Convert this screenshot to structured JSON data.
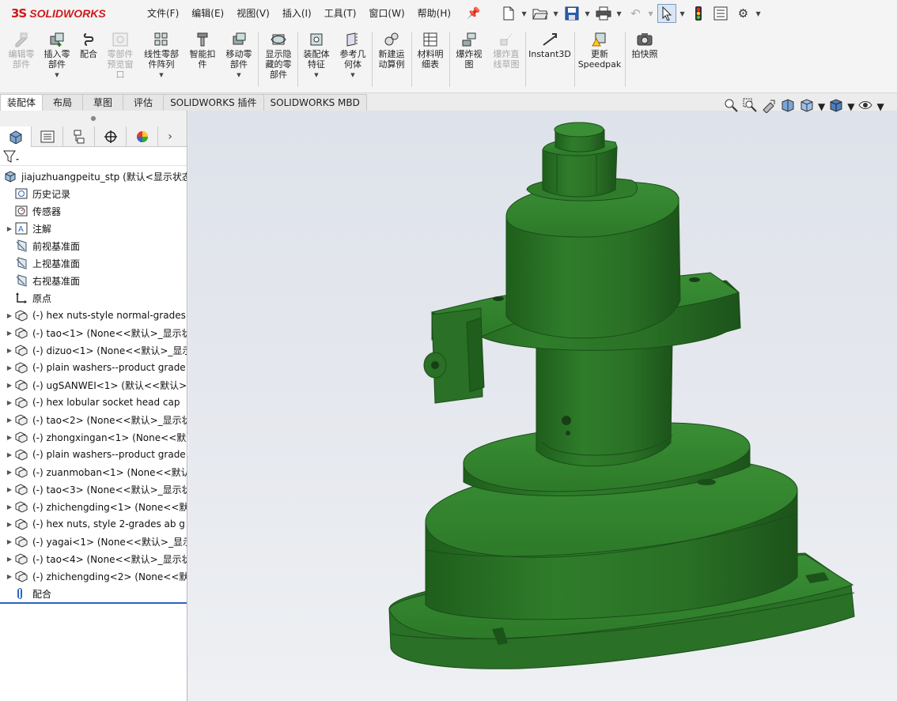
{
  "app": {
    "logo_mark": "3S",
    "logo_text": "SOLIDWORKS"
  },
  "menu": [
    {
      "label": "文件(F)"
    },
    {
      "label": "编辑(E)"
    },
    {
      "label": "视图(V)"
    },
    {
      "label": "插入(I)"
    },
    {
      "label": "工具(T)"
    },
    {
      "label": "窗口(W)"
    },
    {
      "label": "帮助(H)"
    }
  ],
  "quick_access": [
    "new-icon",
    "open-icon",
    "save-icon",
    "print-icon",
    "undo-icon",
    "select-icon",
    "rebuild-icon",
    "file-properties-icon",
    "options-icon"
  ],
  "commands": [
    {
      "l1": "编辑零",
      "l2": "部件",
      "l3": "",
      "disabled": true,
      "icon": "edit-component-icon"
    },
    {
      "l1": "插入零",
      "l2": "部件",
      "l3": "",
      "disabled": false,
      "icon": "insert-component-icon"
    },
    {
      "l1": "配合",
      "l2": "",
      "l3": "",
      "disabled": false,
      "icon": "mate-icon"
    },
    {
      "l1": "零部件",
      "l2": "预览窗",
      "l3": "口",
      "disabled": true,
      "icon": "preview-window-icon"
    },
    {
      "l1": "线性零部",
      "l2": "件阵列",
      "l3": "",
      "disabled": false,
      "icon": "linear-pattern-icon"
    },
    {
      "l1": "智能扣",
      "l2": "件",
      "l3": "",
      "disabled": false,
      "icon": "smart-fastener-icon"
    },
    {
      "l1": "移动零",
      "l2": "部件",
      "l3": "",
      "disabled": false,
      "icon": "move-component-icon"
    },
    {
      "l1": "显示隐",
      "l2": "藏的零",
      "l3": "部件",
      "disabled": false,
      "icon": "show-hidden-icon"
    },
    {
      "l1": "装配体",
      "l2": "特征",
      "l3": "",
      "disabled": false,
      "icon": "assembly-feature-icon"
    },
    {
      "l1": "参考几",
      "l2": "何体",
      "l3": "",
      "disabled": false,
      "icon": "reference-geometry-icon"
    },
    {
      "l1": "新建运",
      "l2": "动算例",
      "l3": "",
      "disabled": false,
      "icon": "motion-study-icon"
    },
    {
      "l1": "材料明",
      "l2": "细表",
      "l3": "",
      "disabled": false,
      "icon": "bom-icon"
    },
    {
      "l1": "爆炸视",
      "l2": "图",
      "l3": "",
      "disabled": false,
      "icon": "exploded-view-icon"
    },
    {
      "l1": "爆炸直",
      "l2": "线草图",
      "l3": "",
      "disabled": true,
      "icon": "explode-line-icon"
    },
    {
      "l1": "Instant3D",
      "l2": "",
      "l3": "",
      "disabled": false,
      "icon": "instant3d-icon"
    },
    {
      "l1": "更新",
      "l2": "Speedpak",
      "l3": "",
      "disabled": false,
      "icon": "speedpak-icon"
    },
    {
      "l1": "拍快照",
      "l2": "",
      "l3": "",
      "disabled": false,
      "icon": "snapshot-icon"
    }
  ],
  "tabs": [
    {
      "label": "装配体",
      "active": true
    },
    {
      "label": "布局"
    },
    {
      "label": "草图"
    },
    {
      "label": "评估"
    },
    {
      "label": "SOLIDWORKS 插件"
    },
    {
      "label": "SOLIDWORKS MBD"
    }
  ],
  "panel_tabs": [
    "featuremanager-icon",
    "propertymanager-icon",
    "configurationmanager-icon",
    "dimxpert-icon",
    "display-manager-icon"
  ],
  "tree": [
    {
      "label": "jiajuzhuangpeitu_stp  (默认<显示状态",
      "icon": "assembly-icon",
      "expander": false,
      "level": 0
    },
    {
      "label": "历史记录",
      "icon": "history-icon",
      "expander": false,
      "level": 1
    },
    {
      "label": "传感器",
      "icon": "sensor-icon",
      "expander": false,
      "level": 1
    },
    {
      "label": "注解",
      "icon": "annotation-icon",
      "expander": true,
      "level": 1
    },
    {
      "label": "前视基准面",
      "icon": "plane-icon",
      "expander": false,
      "level": 1
    },
    {
      "label": "上视基准面",
      "icon": "plane-icon",
      "expander": false,
      "level": 1
    },
    {
      "label": "右视基准面",
      "icon": "plane-icon",
      "expander": false,
      "level": 1
    },
    {
      "label": "原点",
      "icon": "origin-icon",
      "expander": false,
      "level": 1
    },
    {
      "label": "(-) hex nuts-style normal-grades",
      "icon": "part-icon",
      "expander": true,
      "level": 1
    },
    {
      "label": "(-) tao<1> (None<<默认>_显示状",
      "icon": "part-icon",
      "expander": true,
      "level": 1
    },
    {
      "label": "(-) dizuo<1> (None<<默认>_显示",
      "icon": "part-icon",
      "expander": true,
      "level": 1
    },
    {
      "label": "(-) plain washers--product grade",
      "icon": "part-icon",
      "expander": true,
      "level": 1
    },
    {
      "label": "(-) ugSANWEI<1> (默认<<默认>",
      "icon": "part-icon",
      "expander": true,
      "level": 1
    },
    {
      "label": "(-) hex lobular socket head cap",
      "icon": "part-icon",
      "expander": true,
      "level": 1
    },
    {
      "label": "(-) tao<2> (None<<默认>_显示状",
      "icon": "part-icon",
      "expander": true,
      "level": 1
    },
    {
      "label": "(-) zhongxingan<1> (None<<默",
      "icon": "part-icon",
      "expander": true,
      "level": 1
    },
    {
      "label": "(-) plain washers--product grade",
      "icon": "part-icon",
      "expander": true,
      "level": 1
    },
    {
      "label": "(-) zuanmoban<1> (None<<默认",
      "icon": "part-icon",
      "expander": true,
      "level": 1
    },
    {
      "label": "(-) tao<3> (None<<默认>_显示状",
      "icon": "part-icon",
      "expander": true,
      "level": 1
    },
    {
      "label": "(-) zhichengding<1> (None<<默",
      "icon": "part-icon",
      "expander": true,
      "level": 1
    },
    {
      "label": "(-) hex nuts, style 2-grades ab g",
      "icon": "part-icon",
      "expander": true,
      "level": 1
    },
    {
      "label": "(-) yagai<1> (None<<默认>_显示",
      "icon": "part-icon",
      "expander": true,
      "level": 1
    },
    {
      "label": "(-) tao<4> (None<<默认>_显示状",
      "icon": "part-icon",
      "expander": true,
      "level": 1
    },
    {
      "label": "(-) zhichengding<2> (None<<默",
      "icon": "part-icon",
      "expander": true,
      "level": 1
    },
    {
      "label": "配合",
      "icon": "mates-folder-icon",
      "expander": false,
      "level": 1
    }
  ],
  "heads_up_toolbar": [
    "zoom-to-fit-icon",
    "zoom-to-area-icon",
    "previous-view-icon",
    "section-view-icon",
    "view-orientation-icon",
    "display-style-icon",
    "hide-show-icon"
  ],
  "colors": {
    "model_green": "#2f7a2b",
    "model_dark": "#1d5a1a",
    "accent_blue": "#2b63c0",
    "logo_red": "#d01a1a"
  }
}
